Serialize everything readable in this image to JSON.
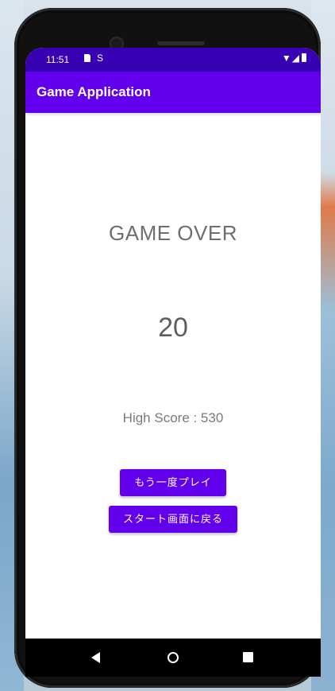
{
  "status_bar": {
    "time": "11:51",
    "sim_icon": "sd-card-icon",
    "sync_icon": "s-icon",
    "right_icons": "▼◢"
  },
  "app_bar": {
    "title": "Game Application"
  },
  "game": {
    "game_over_label": "GAME OVER",
    "score": "20",
    "high_score_text": "High Score : 530"
  },
  "buttons": {
    "replay_label": "もう一度プレイ",
    "home_label": "スタート画面に戻る"
  },
  "colors": {
    "primary": "#6200ee",
    "status_bar": "#3700b3"
  },
  "nav_bar": {
    "back_icon": "back-triangle-icon",
    "home_icon": "home-circle-icon",
    "recents_icon": "recents-square-icon"
  }
}
